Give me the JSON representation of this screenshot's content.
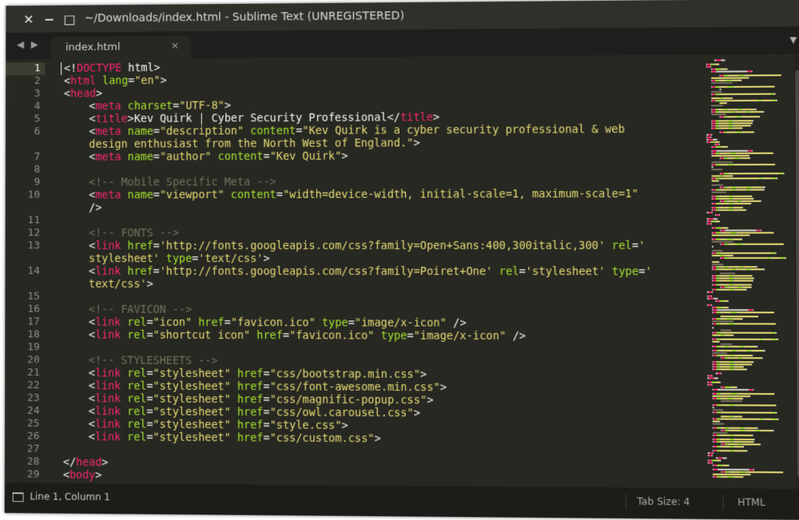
{
  "window": {
    "title": "~/Downloads/index.html - Sublime Text (UNREGISTERED)",
    "controls": {
      "close": "✕",
      "minimize": "−",
      "maximize": "□"
    }
  },
  "tabs": {
    "nav_left": "◀",
    "nav_right": "▶",
    "active": {
      "label": "index.html",
      "close": "×"
    },
    "dropdown": "▼"
  },
  "editor": {
    "line_numbers": [
      "1",
      "2",
      "3",
      "4",
      "5",
      "6",
      "7",
      "8",
      "9",
      "10",
      "11",
      "12",
      "13",
      "14",
      "15",
      "16",
      "17",
      "18",
      "19",
      "20",
      "21",
      "22",
      "23",
      "24",
      "25",
      "26",
      "27",
      "28",
      "29"
    ],
    "colors": {
      "background": "#272822",
      "tag": "#f92672",
      "attribute": "#a6e22e",
      "string": "#e6db74",
      "comment": "#75715e",
      "text": "#f8f8f2"
    }
  },
  "status": {
    "position": "Line 1, Column 1",
    "tab_size": "Tab Size: 4",
    "syntax": "HTML"
  }
}
